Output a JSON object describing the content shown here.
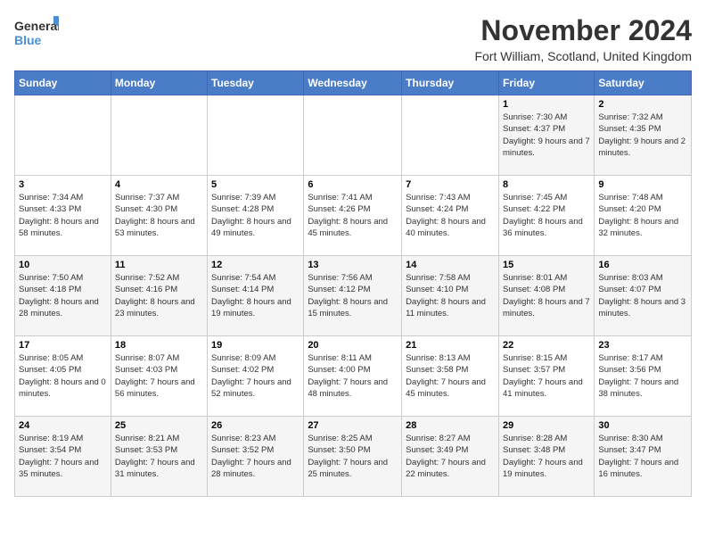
{
  "logo": {
    "line1": "General",
    "line2": "Blue"
  },
  "title": "November 2024",
  "subtitle": "Fort William, Scotland, United Kingdom",
  "days_of_week": [
    "Sunday",
    "Monday",
    "Tuesday",
    "Wednesday",
    "Thursday",
    "Friday",
    "Saturday"
  ],
  "weeks": [
    [
      {
        "day": "",
        "info": ""
      },
      {
        "day": "",
        "info": ""
      },
      {
        "day": "",
        "info": ""
      },
      {
        "day": "",
        "info": ""
      },
      {
        "day": "",
        "info": ""
      },
      {
        "day": "1",
        "info": "Sunrise: 7:30 AM\nSunset: 4:37 PM\nDaylight: 9 hours and 7 minutes."
      },
      {
        "day": "2",
        "info": "Sunrise: 7:32 AM\nSunset: 4:35 PM\nDaylight: 9 hours and 2 minutes."
      }
    ],
    [
      {
        "day": "3",
        "info": "Sunrise: 7:34 AM\nSunset: 4:33 PM\nDaylight: 8 hours and 58 minutes."
      },
      {
        "day": "4",
        "info": "Sunrise: 7:37 AM\nSunset: 4:30 PM\nDaylight: 8 hours and 53 minutes."
      },
      {
        "day": "5",
        "info": "Sunrise: 7:39 AM\nSunset: 4:28 PM\nDaylight: 8 hours and 49 minutes."
      },
      {
        "day": "6",
        "info": "Sunrise: 7:41 AM\nSunset: 4:26 PM\nDaylight: 8 hours and 45 minutes."
      },
      {
        "day": "7",
        "info": "Sunrise: 7:43 AM\nSunset: 4:24 PM\nDaylight: 8 hours and 40 minutes."
      },
      {
        "day": "8",
        "info": "Sunrise: 7:45 AM\nSunset: 4:22 PM\nDaylight: 8 hours and 36 minutes."
      },
      {
        "day": "9",
        "info": "Sunrise: 7:48 AM\nSunset: 4:20 PM\nDaylight: 8 hours and 32 minutes."
      }
    ],
    [
      {
        "day": "10",
        "info": "Sunrise: 7:50 AM\nSunset: 4:18 PM\nDaylight: 8 hours and 28 minutes."
      },
      {
        "day": "11",
        "info": "Sunrise: 7:52 AM\nSunset: 4:16 PM\nDaylight: 8 hours and 23 minutes."
      },
      {
        "day": "12",
        "info": "Sunrise: 7:54 AM\nSunset: 4:14 PM\nDaylight: 8 hours and 19 minutes."
      },
      {
        "day": "13",
        "info": "Sunrise: 7:56 AM\nSunset: 4:12 PM\nDaylight: 8 hours and 15 minutes."
      },
      {
        "day": "14",
        "info": "Sunrise: 7:58 AM\nSunset: 4:10 PM\nDaylight: 8 hours and 11 minutes."
      },
      {
        "day": "15",
        "info": "Sunrise: 8:01 AM\nSunset: 4:08 PM\nDaylight: 8 hours and 7 minutes."
      },
      {
        "day": "16",
        "info": "Sunrise: 8:03 AM\nSunset: 4:07 PM\nDaylight: 8 hours and 3 minutes."
      }
    ],
    [
      {
        "day": "17",
        "info": "Sunrise: 8:05 AM\nSunset: 4:05 PM\nDaylight: 8 hours and 0 minutes."
      },
      {
        "day": "18",
        "info": "Sunrise: 8:07 AM\nSunset: 4:03 PM\nDaylight: 7 hours and 56 minutes."
      },
      {
        "day": "19",
        "info": "Sunrise: 8:09 AM\nSunset: 4:02 PM\nDaylight: 7 hours and 52 minutes."
      },
      {
        "day": "20",
        "info": "Sunrise: 8:11 AM\nSunset: 4:00 PM\nDaylight: 7 hours and 48 minutes."
      },
      {
        "day": "21",
        "info": "Sunrise: 8:13 AM\nSunset: 3:58 PM\nDaylight: 7 hours and 45 minutes."
      },
      {
        "day": "22",
        "info": "Sunrise: 8:15 AM\nSunset: 3:57 PM\nDaylight: 7 hours and 41 minutes."
      },
      {
        "day": "23",
        "info": "Sunrise: 8:17 AM\nSunset: 3:56 PM\nDaylight: 7 hours and 38 minutes."
      }
    ],
    [
      {
        "day": "24",
        "info": "Sunrise: 8:19 AM\nSunset: 3:54 PM\nDaylight: 7 hours and 35 minutes."
      },
      {
        "day": "25",
        "info": "Sunrise: 8:21 AM\nSunset: 3:53 PM\nDaylight: 7 hours and 31 minutes."
      },
      {
        "day": "26",
        "info": "Sunrise: 8:23 AM\nSunset: 3:52 PM\nDaylight: 7 hours and 28 minutes."
      },
      {
        "day": "27",
        "info": "Sunrise: 8:25 AM\nSunset: 3:50 PM\nDaylight: 7 hours and 25 minutes."
      },
      {
        "day": "28",
        "info": "Sunrise: 8:27 AM\nSunset: 3:49 PM\nDaylight: 7 hours and 22 minutes."
      },
      {
        "day": "29",
        "info": "Sunrise: 8:28 AM\nSunset: 3:48 PM\nDaylight: 7 hours and 19 minutes."
      },
      {
        "day": "30",
        "info": "Sunrise: 8:30 AM\nSunset: 3:47 PM\nDaylight: 7 hours and 16 minutes."
      }
    ]
  ],
  "accent_color": "#4a7cc7"
}
